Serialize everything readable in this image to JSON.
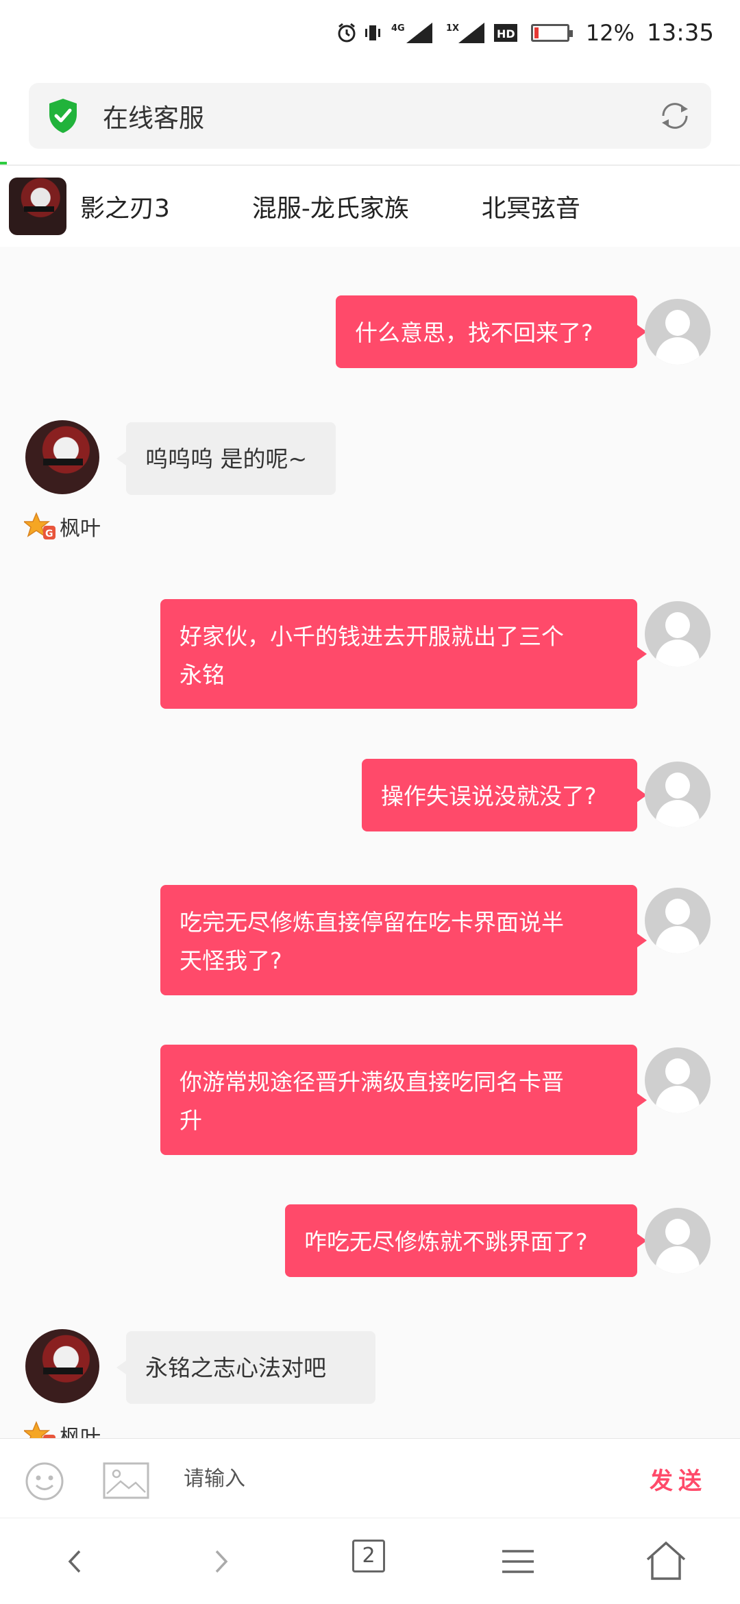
{
  "status_bar": {
    "network_label": "4G",
    "sim2_label": "1X",
    "hd_label": "HD",
    "battery": "12%",
    "time": "13:35"
  },
  "header": {
    "title": "在线客服"
  },
  "game_tabs": [
    {
      "label": "影之刃3"
    },
    {
      "label": "混服-龙氏家族"
    },
    {
      "label": "北冥弦音"
    }
  ],
  "messages": [
    {
      "from": "user",
      "text": "什么意思，找不回来了?"
    },
    {
      "from": "agent",
      "text": "呜呜呜 是的呢~",
      "name": "枫叶"
    },
    {
      "from": "user",
      "lines": [
        "好家伙，小千的钱进去开服就出了三个",
        "永铭"
      ]
    },
    {
      "from": "user",
      "text": "操作失误说没就没了?"
    },
    {
      "from": "user",
      "lines": [
        "吃完无尽修炼直接停留在吃卡界面说半",
        "天怪我了?"
      ]
    },
    {
      "from": "user",
      "lines": [
        "你游常规途径晋升满级直接吃同名卡晋",
        "升"
      ]
    },
    {
      "from": "user",
      "text": "咋吃无尽修炼就不跳界面了?"
    },
    {
      "from": "agent",
      "text": "永铭之志心法对吧",
      "name": "枫叶"
    }
  ],
  "input": {
    "placeholder": "请输入",
    "send_label": "发送"
  },
  "nav": {
    "tab_count": "2"
  },
  "colors": {
    "accent": "#ff4a6a",
    "shield": "#21b33b"
  }
}
